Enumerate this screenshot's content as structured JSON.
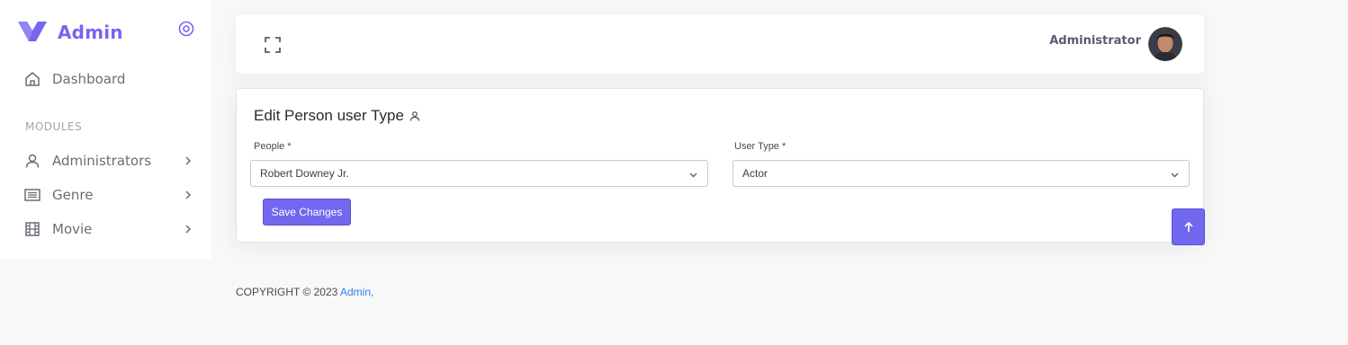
{
  "brand": {
    "name": "Admin",
    "logo_icon": "vuexy-v-logo",
    "accent": "#7367f0"
  },
  "sidebar": {
    "dashboard_label": "Dashboard",
    "section_header": "MODULES",
    "items": [
      {
        "label": "Administrators",
        "icon": "user-icon"
      },
      {
        "label": "Genre",
        "icon": "list-icon"
      },
      {
        "label": "Movie",
        "icon": "film-icon"
      }
    ]
  },
  "navbar": {
    "user_name": "Administrator"
  },
  "form": {
    "title": "Edit Person user Type",
    "people_label": "People *",
    "people_value": "Robert Downey Jr.",
    "user_type_label": "User Type *",
    "user_type_value": "Actor",
    "save_label": "Save Changes"
  },
  "footer": {
    "text": "COPYRIGHT © 2023 ",
    "link": "Admin,"
  }
}
